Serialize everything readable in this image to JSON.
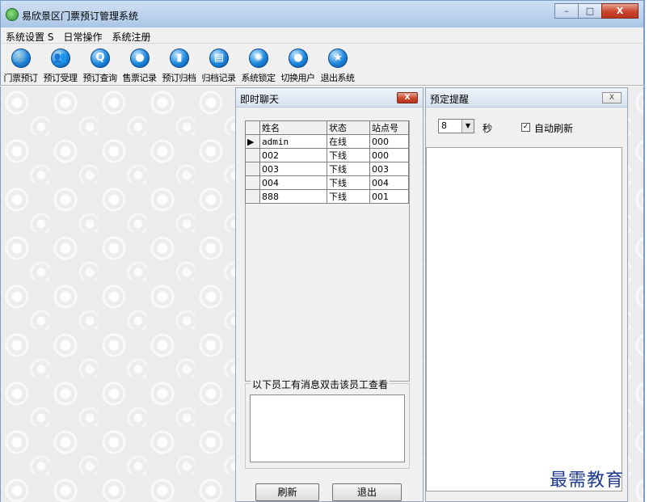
{
  "window": {
    "title": "易欣景区门票预订管理系统",
    "minimize": "–",
    "maximize": "□",
    "close": "X"
  },
  "menu": [
    {
      "label": "系统设置 S"
    },
    {
      "label": "日常操作"
    },
    {
      "label": "系统注册"
    }
  ],
  "toolbar": [
    {
      "label": "门票预订",
      "icon": "cart-icon",
      "glyph": "🛒"
    },
    {
      "label": "预订受理",
      "icon": "users-icon",
      "glyph": "👥"
    },
    {
      "label": "预订查询",
      "icon": "search-icon",
      "glyph": "Q"
    },
    {
      "label": "售票记录",
      "icon": "chat-icon",
      "glyph": "●"
    },
    {
      "label": "预订归档",
      "icon": "bar-chart-icon",
      "glyph": "▮"
    },
    {
      "label": "归档记录",
      "icon": "document-icon",
      "glyph": "▤"
    },
    {
      "label": "系统锁定",
      "icon": "gear-icon",
      "glyph": "✺"
    },
    {
      "label": "切换用户",
      "icon": "speech-icon",
      "glyph": "●"
    },
    {
      "label": "退出系统",
      "icon": "star-icon",
      "glyph": "★"
    }
  ],
  "chat": {
    "title": "即时聊天",
    "close": "X",
    "columns": [
      "姓名",
      "状态",
      "站点号"
    ],
    "rows": [
      {
        "name": "admin",
        "status": "在线",
        "site": "000",
        "current": true
      },
      {
        "name": "002",
        "status": "下线",
        "site": "000"
      },
      {
        "name": "003",
        "status": "下线",
        "site": "003"
      },
      {
        "name": "004",
        "status": "下线",
        "site": "004"
      },
      {
        "name": "888",
        "status": "下线",
        "site": "001"
      }
    ],
    "messages_legend": "以下员工有消息双击该员工查看",
    "refresh_label": "刷新",
    "exit_label": "退出"
  },
  "reminder": {
    "title": "预定提醒",
    "close": "X",
    "interval_value": "8",
    "interval_unit": "秒",
    "auto_refresh_label": "自动刷新",
    "auto_refresh_checked": true
  },
  "watermark": "最需教育"
}
